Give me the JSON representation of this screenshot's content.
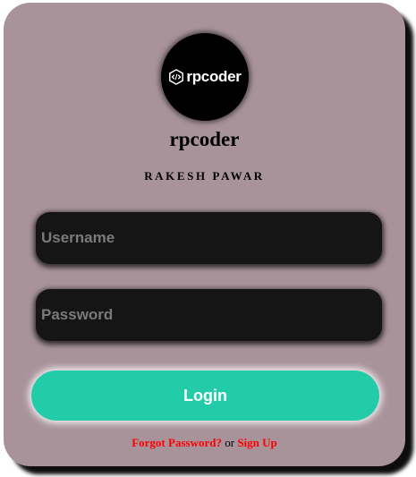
{
  "logo": {
    "text": "rpcoder",
    "icon": "code-brackets-icon"
  },
  "brand": {
    "title": "rpcoder",
    "author": "RAKESH PAWAR"
  },
  "form": {
    "username_placeholder": "Username",
    "password_placeholder": "Password",
    "login_label": "Login"
  },
  "links": {
    "forgot": "Forgot Password?",
    "separator": "or",
    "signup": "Sign Up"
  },
  "colors": {
    "card_background": "#a8939a",
    "input_background": "#151515",
    "login_button": "#22cca8",
    "link_color": "#ff0000"
  }
}
